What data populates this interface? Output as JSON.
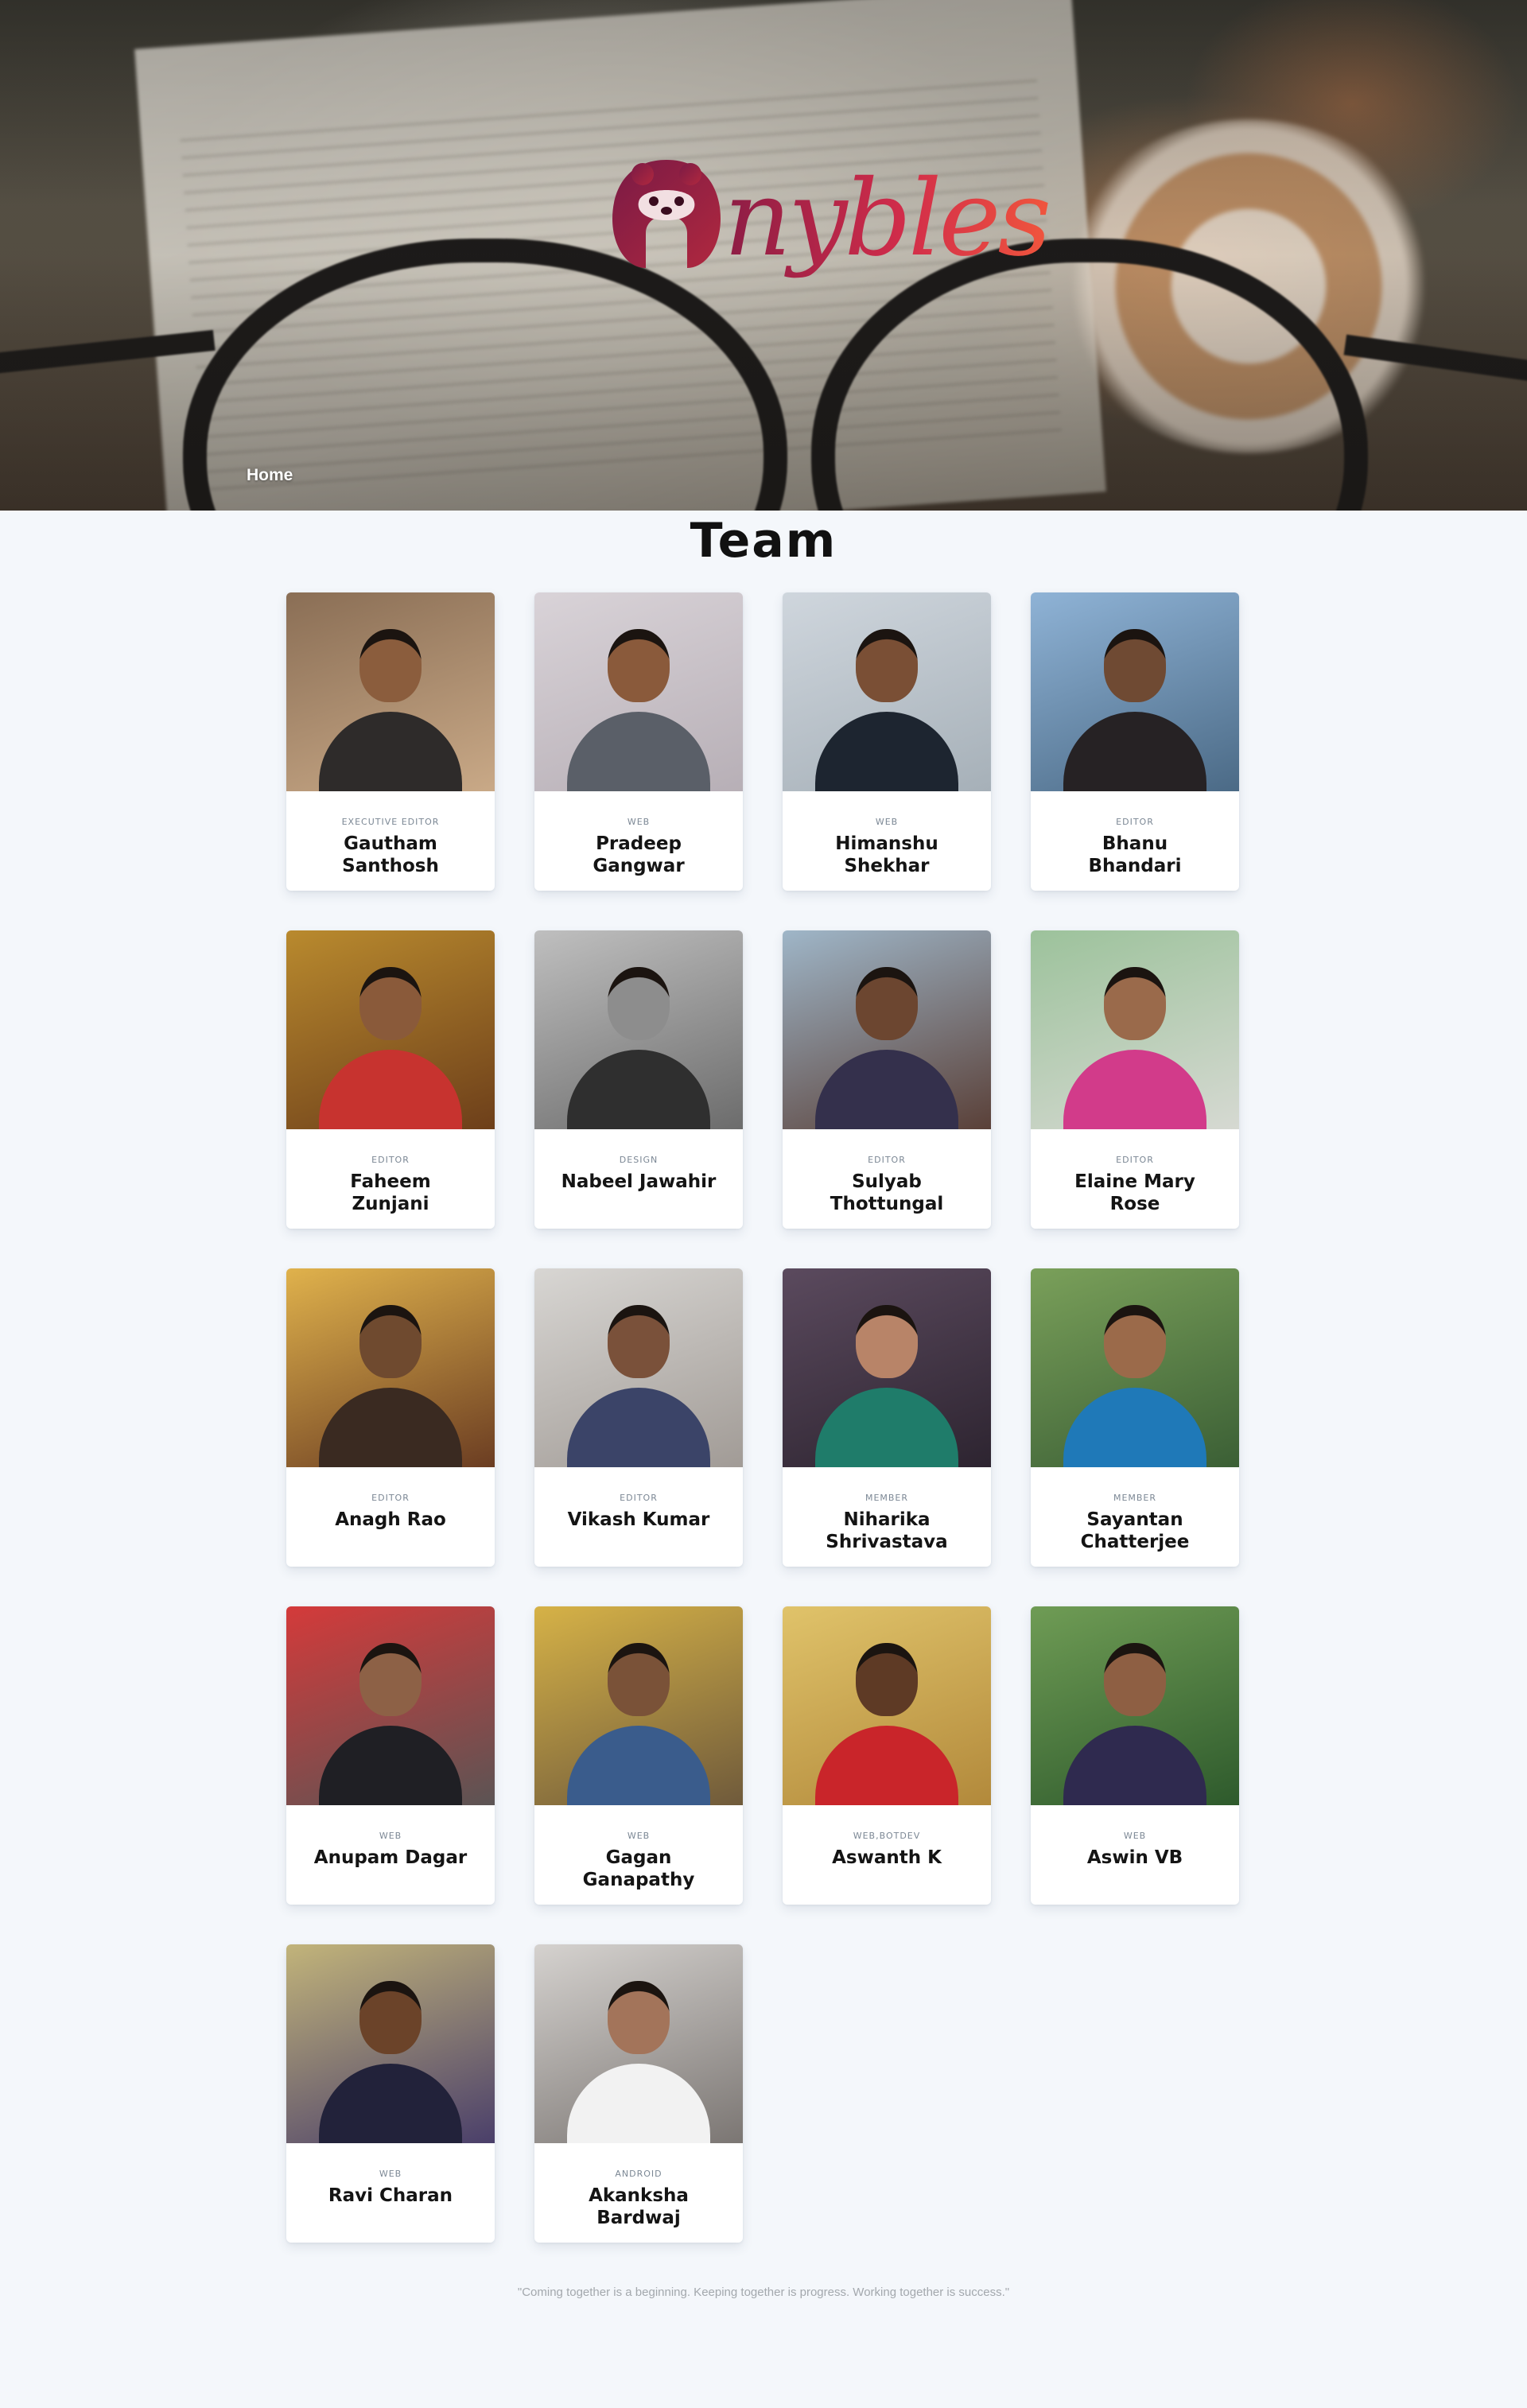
{
  "header": {
    "brand": "nybles",
    "nav_home": "Home"
  },
  "page_title": "Team",
  "members": [
    {
      "role": "EXECUTIVE EDITOR",
      "name": "Gautham Santhosh",
      "photo_bg": [
        "#8a6e55",
        "#c9a987"
      ],
      "skin": "#8b5d3d",
      "shirt": "#2e2b2a"
    },
    {
      "role": "WEB",
      "name": "Pradeep Gangwar",
      "photo_bg": [
        "#d9d3d8",
        "#b7afb6"
      ],
      "skin": "#8a5a3b",
      "shirt": "#5a5f68"
    },
    {
      "role": "WEB",
      "name": "Himanshu Shekhar",
      "photo_bg": [
        "#cfd6dd",
        "#a6b0b8"
      ],
      "skin": "#7a4f35",
      "shirt": "#1d2530"
    },
    {
      "role": "EDITOR",
      "name": "Bhanu Bhandari",
      "photo_bg": [
        "#8fb3d6",
        "#4b6a86"
      ],
      "skin": "#6f4a33",
      "shirt": "#262224"
    },
    {
      "role": "EDITOR",
      "name": "Faheem Zunjani",
      "photo_bg": [
        "#b98a2e",
        "#6d3f1a"
      ],
      "skin": "#8a5a3a",
      "shirt": "#c7332f"
    },
    {
      "role": "DESIGN",
      "name": "Nabeel Jawahir",
      "photo_bg": [
        "#bfbfbf",
        "#6c6c6c"
      ],
      "skin": "#8d8d8d",
      "shirt": "#2f2f2f"
    },
    {
      "role": "EDITOR",
      "name": "Sulyab Thottungal",
      "photo_bg": [
        "#9fb6c8",
        "#5a4038"
      ],
      "skin": "#6c4630",
      "shirt": "#34304c"
    },
    {
      "role": "EDITOR",
      "name": "Elaine Mary Rose",
      "photo_bg": [
        "#9cc29b",
        "#d6d9d2"
      ],
      "skin": "#9a6a4b",
      "shirt": "#d23b8a"
    },
    {
      "role": "EDITOR",
      "name": "Anagh Rao",
      "photo_bg": [
        "#e0b24c",
        "#6b3d22"
      ],
      "skin": "#6f4a2f",
      "shirt": "#3a2a21"
    },
    {
      "role": "EDITOR",
      "name": "Vikash Kumar",
      "photo_bg": [
        "#d8d6d3",
        "#a19b96"
      ],
      "skin": "#7a513a",
      "shirt": "#3b4468"
    },
    {
      "role": "MEMBER",
      "name": "Niharika Shrivastava",
      "photo_bg": [
        "#5b4a5e",
        "#2d2430"
      ],
      "skin": "#b88468",
      "shirt": "#1f7c6a"
    },
    {
      "role": "MEMBER",
      "name": "Sayantan Chatterjee",
      "photo_bg": [
        "#7aa05a",
        "#3b5f35"
      ],
      "skin": "#9b6a4a",
      "shirt": "#1f79b8"
    },
    {
      "role": "WEB",
      "name": "Anupam Dagar",
      "photo_bg": [
        "#d43a3a",
        "#5b5454"
      ],
      "skin": "#8d6146",
      "shirt": "#1f1f24"
    },
    {
      "role": "WEB",
      "name": "Gagan Ganapathy",
      "photo_bg": [
        "#d6b247",
        "#6f5a3b"
      ],
      "skin": "#7a5238",
      "shirt": "#3a5c8c"
    },
    {
      "role": "WEB,BOTDEV",
      "name": "Aswanth K",
      "photo_bg": [
        "#e0c36a",
        "#b2893b"
      ],
      "skin": "#5e3a25",
      "shirt": "#c9252a"
    },
    {
      "role": "WEB",
      "name": "Aswin VB",
      "photo_bg": [
        "#6f9c55",
        "#2e5a2c"
      ],
      "skin": "#8e5f43",
      "shirt": "#2f2a4f"
    },
    {
      "role": "WEB",
      "name": "Ravi Charan",
      "photo_bg": [
        "#c2b47a",
        "#4a3f6a"
      ],
      "skin": "#6b4329",
      "shirt": "#22223a"
    },
    {
      "role": "ANDROID",
      "name": "Akanksha Bardwaj",
      "photo_bg": [
        "#d5d2cf",
        "#7b7673"
      ],
      "skin": "#a3745a",
      "shirt": "#f2f2f2"
    }
  ],
  "footer": {
    "quote": "\"Coming together is a beginning. Keeping together is progress. Working together is success.\""
  },
  "colors": {
    "brand_start": "#8c1d45",
    "brand_end": "#f0553d",
    "page_bg": "#f4f7fb"
  }
}
